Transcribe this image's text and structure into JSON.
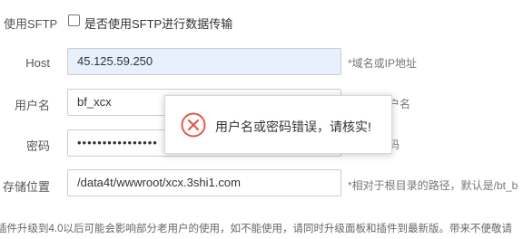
{
  "sftp": {
    "label": "使用SFTP",
    "checkbox_label": "是否使用SFTP进行数据传输",
    "checked": false
  },
  "host": {
    "label": "Host",
    "value": "45.125.59.250",
    "hint": "*域名或IP地址"
  },
  "username": {
    "label": "用户名",
    "value": "bf_xcx",
    "hint_partial": "户名"
  },
  "password": {
    "label": "密码",
    "value": "••••••••••••••••",
    "hint_partial": "码"
  },
  "storage": {
    "label": "存储位置",
    "value": "/data4t/wwwroot/xcx.3shi1.com",
    "hint": "*相对于根目录的路径，默认是/bt_b"
  },
  "toast": {
    "message": "用户名或密码错误，请核实!",
    "icon": "error-circle-x-icon",
    "icon_color": "#e05b4b"
  },
  "notice": "插件升级到4.0以后可能会影响部分老用户的使用，如不能使用，请同时升级面板和插件到最新版。带来不便敬请"
}
